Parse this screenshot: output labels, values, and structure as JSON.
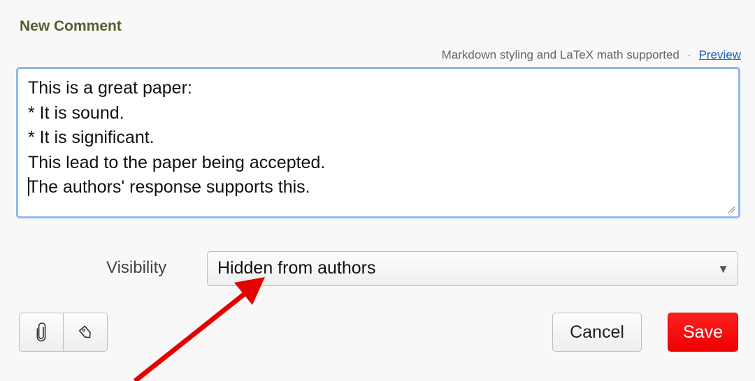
{
  "form": {
    "heading": "New Comment",
    "help_text": "Markdown styling and LaTeX math supported",
    "separator": "·",
    "preview_link": "Preview"
  },
  "editor": {
    "lines": [
      "This is a great paper:",
      "* It is sound.",
      "* It is significant.",
      "This lead to the paper being accepted.",
      "The authors' response supports this."
    ]
  },
  "visibility": {
    "label": "Visibility",
    "selected": "Hidden from authors"
  },
  "toolbar": {
    "icons": [
      "paperclip-icon",
      "tag-icon"
    ]
  },
  "actions": {
    "cancel_label": "Cancel",
    "save_label": "Save"
  },
  "colors": {
    "heading": "#5a5a2e",
    "link": "#1a5fb4",
    "focus_border": "#8fb8ee",
    "save_button": "#ff1a1a",
    "annotation_arrow": "#e60000"
  }
}
